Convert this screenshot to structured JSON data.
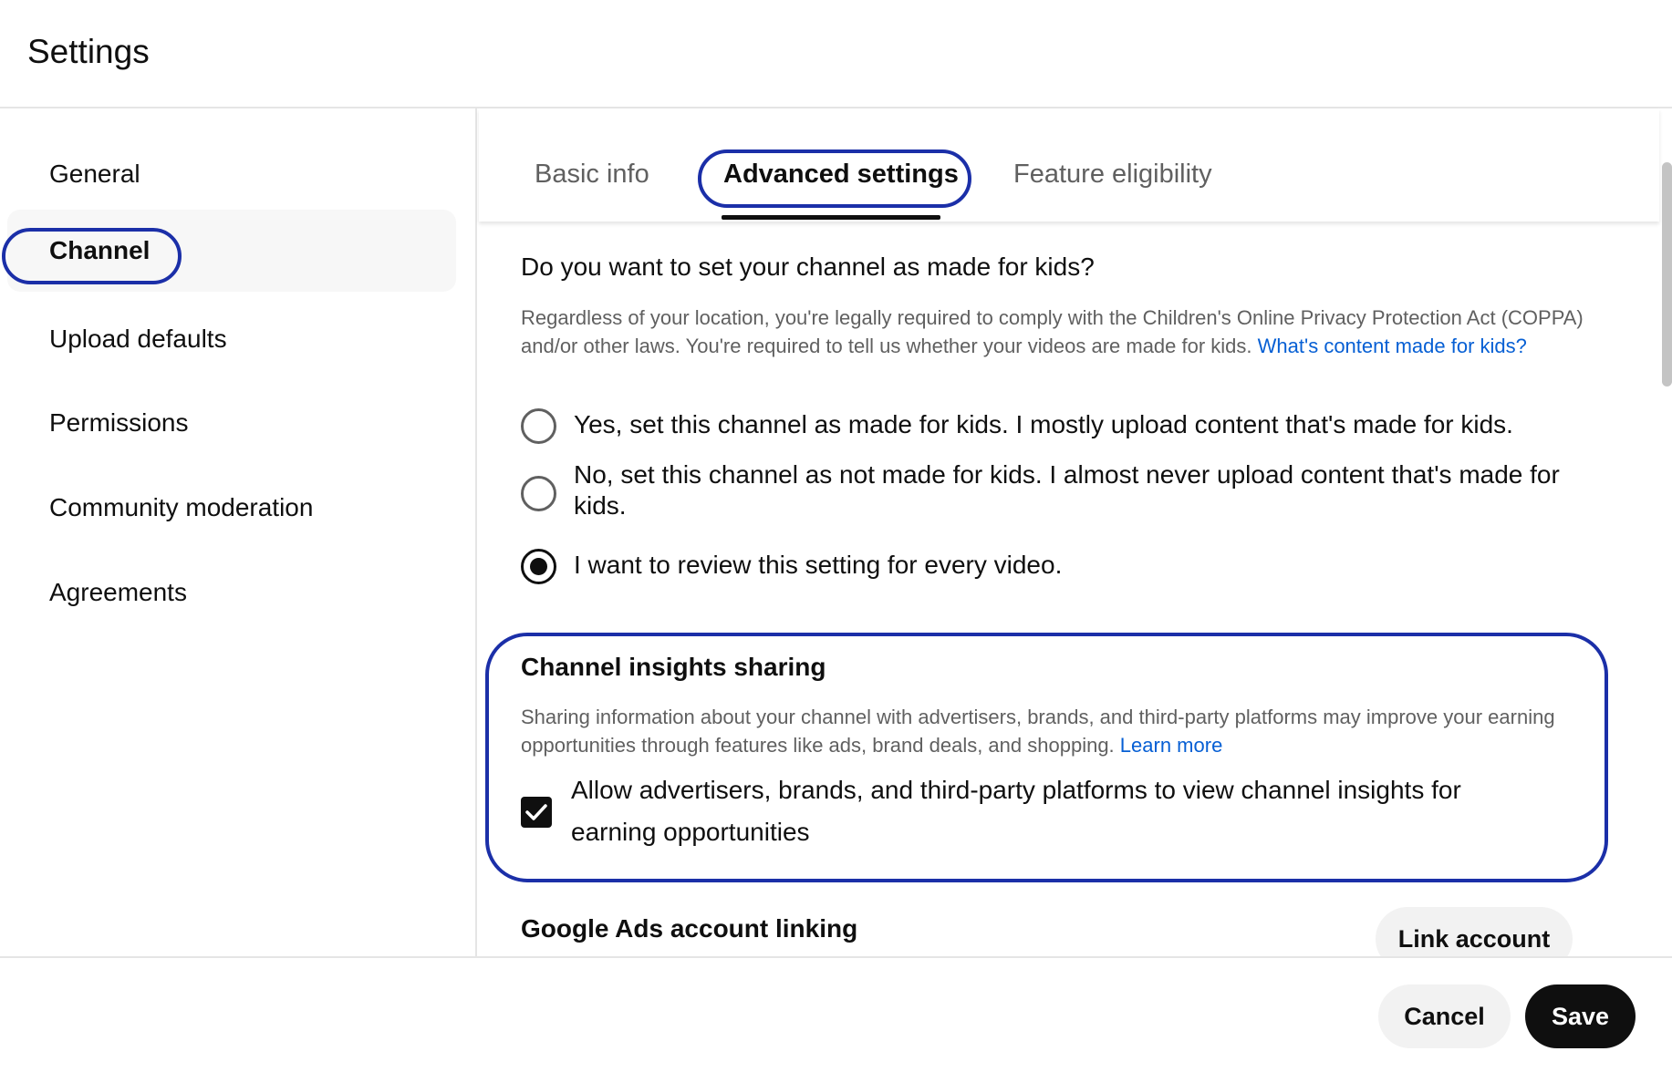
{
  "header": {
    "title": "Settings"
  },
  "sidebar": {
    "items": [
      {
        "label": "General"
      },
      {
        "label": "Channel"
      },
      {
        "label": "Upload defaults"
      },
      {
        "label": "Permissions"
      },
      {
        "label": "Community moderation"
      },
      {
        "label": "Agreements"
      }
    ],
    "active": "Channel"
  },
  "tabs": {
    "items": [
      {
        "label": "Basic info"
      },
      {
        "label": "Advanced settings"
      },
      {
        "label": "Feature eligibility"
      }
    ],
    "active": "Advanced settings"
  },
  "kids": {
    "question": "Do you want to set your channel as made for kids?",
    "description": "Regardless of your location, you're legally required to comply with the Children's Online Privacy Protection Act (COPPA) and/or other laws. You're required to tell us whether your videos are made for kids.",
    "link": "What's content made for kids?",
    "options": [
      {
        "label": "Yes, set this channel as made for kids. I mostly upload content that's made for kids.",
        "checked": false
      },
      {
        "label": "No, set this channel as not made for kids. I almost never upload content that's made for kids.",
        "checked": false
      },
      {
        "label": "I want to review this setting for every video.",
        "checked": true
      }
    ]
  },
  "insights": {
    "title": "Channel insights sharing",
    "description": "Sharing information about your channel with advertisers, brands, and third-party platforms may improve your earning opportunities through features like ads, brand deals, and shopping.",
    "link": "Learn more",
    "checkbox_label": "Allow advertisers, brands, and third-party platforms to view channel insights for earning opportunities",
    "checked": true
  },
  "ads": {
    "title": "Google Ads account linking",
    "button": "Link account"
  },
  "footer": {
    "cancel": "Cancel",
    "save": "Save"
  },
  "colors": {
    "highlight": "#1b2fa8",
    "link": "#065fd4",
    "primary": "#0f0f0f"
  }
}
